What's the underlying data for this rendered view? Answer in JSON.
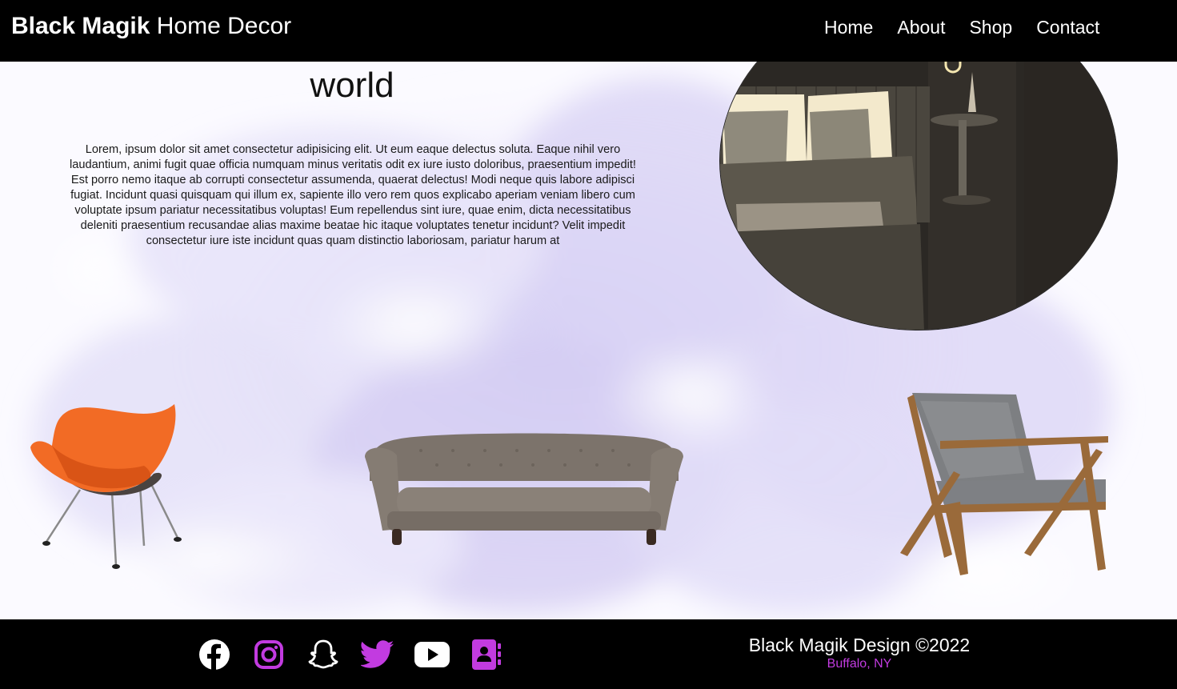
{
  "header": {
    "brand_bold": "Black Magik",
    "brand_rest": " Home Decor",
    "nav": [
      "Home",
      "About",
      "Shop",
      "Contact"
    ]
  },
  "hero": {
    "title": "world",
    "body": "Lorem, ipsum dolor sit amet consectetur adipisicing elit. Ut eum eaque delectus soluta. Eaque nihil vero laudantium, animi fugit quae officia numquam minus veritatis odit ex iure iusto doloribus, praesentium impedit! Est porro nemo itaque ab corrupti consectetur assumenda, quaerat delectus! Modi neque quis labore adipisci fugiat. Incidunt quasi quisquam qui illum ex, sapiente illo vero rem quos explicabo aperiam veniam libero cum voluptate ipsum pariatur necessitatibus voluptas! Eum repellendus sint iure, quae enim, dicta necessitatibus deleniti praesentium recusandae alias maxime beatae hic itaque voluptates tenetur incidunt? Velit impedit consectetur iure iste incidunt quas quam distinctio laboriosam, pariatur harum at"
  },
  "footer": {
    "title": "Black Magik Design ©2022",
    "location": "Buffalo, NY",
    "social_icons": [
      "facebook-icon",
      "instagram-icon",
      "snapchat-icon",
      "twitter-icon",
      "youtube-icon",
      "contacts-icon"
    ]
  },
  "colors": {
    "header_bg": "#000000",
    "accent_purple": "#c23be0",
    "smoke": "#d9d4f4"
  }
}
